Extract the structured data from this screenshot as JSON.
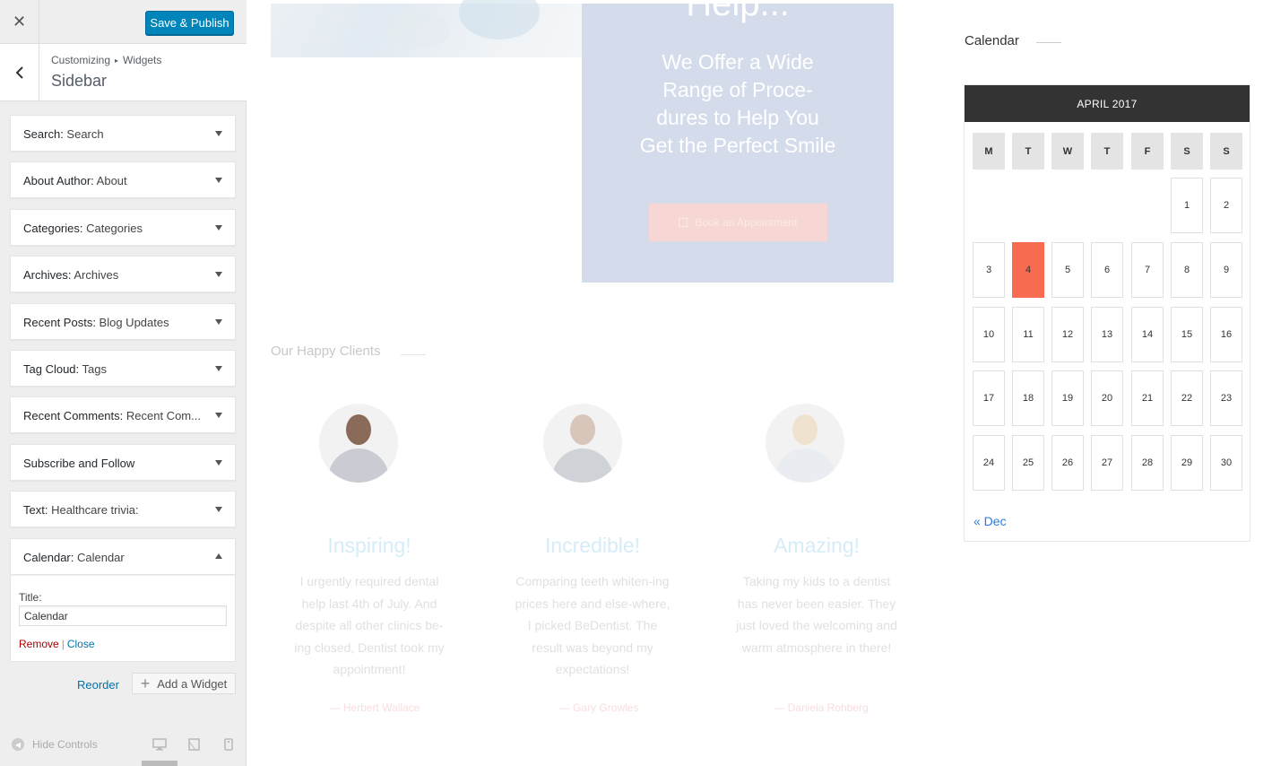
{
  "customizer": {
    "close_icon": "close-icon",
    "save_label": "Save & Publish",
    "breadcrumb_root": "Customizing",
    "breadcrumb_child": "Widgets",
    "section_title": "Sidebar",
    "widgets": [
      {
        "type": "Search:",
        "title": " Search"
      },
      {
        "type": "About Author:",
        "title": " About"
      },
      {
        "type": "Categories:",
        "title": " Categories"
      },
      {
        "type": "Archives:",
        "title": " Archives"
      },
      {
        "type": "Recent Posts:",
        "title": " Blog Updates"
      },
      {
        "type": "Tag Cloud:",
        "title": " Tags"
      },
      {
        "type": "Recent Comments:",
        "title": " Recent Com..."
      },
      {
        "type": "Subscribe and Follow",
        "title": ""
      },
      {
        "type": "Text:",
        "title": " Healthcare trivia:"
      },
      {
        "type": "Calendar:",
        "title": " Calendar"
      }
    ],
    "expanded_widget": {
      "title_label": "Title:",
      "title_value": "Calendar",
      "remove_label": "Remove",
      "separator": "|",
      "close_label": "Close"
    },
    "reorder_label": "Reorder",
    "add_widget_label": "Add a Widget",
    "hide_controls_label": "Hide Controls"
  },
  "preview": {
    "promo_top": "Help...",
    "promo_text": "We Offer a Wide Range of Proce-dures to Help You Get the Perfect Smile",
    "book_label": "Book an Appointment",
    "clients_title": "Our Happy Clients",
    "clients": [
      {
        "name": "Inspiring!",
        "quote": "I urgently required dental help last 4th of July. And despite all other clinics be-ing closed, Dentist took my appointment!",
        "author": "— Herbert Wallace"
      },
      {
        "name": "Incredible!",
        "quote": "Comparing teeth whiten-ing prices here and else-where, I picked BeDentist. The result was beyond my expectations!",
        "author": "— Gary Growles"
      },
      {
        "name": "Amazing!",
        "quote": "Taking my kids to a dentist has never been easier. They just loved the welcoming and warm atmosphere in there!",
        "author": "— Daniela Rohberg"
      }
    ],
    "calendar": {
      "heading": "Calendar",
      "month": "APRIL 2017",
      "days_of_week": [
        "M",
        "T",
        "W",
        "T",
        "F",
        "S",
        "S"
      ],
      "first_weekday_index": 5,
      "days_in_month": 30,
      "today": 4,
      "prev_link": "« Dec",
      "today_color": "#f76b50"
    }
  }
}
